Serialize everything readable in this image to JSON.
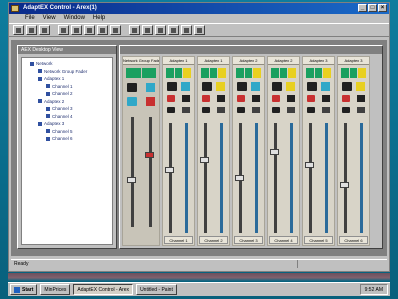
{
  "window": {
    "title": "AdaptEX Control - Arex(1)",
    "buttons": [
      "_",
      "□",
      "×"
    ]
  },
  "menu": [
    "File",
    "View",
    "Window",
    "Help"
  ],
  "toolbar": {
    "buttons": 14
  },
  "tree": {
    "caption": "AEX Desktop View",
    "nodes": [
      {
        "label": "Network",
        "level": 1
      },
      {
        "label": "Network Group Fader",
        "level": 2
      },
      {
        "label": "Adaptex 1",
        "level": 2
      },
      {
        "label": "Channel 1",
        "level": 3
      },
      {
        "label": "Channel 2",
        "level": 3
      },
      {
        "label": "Adaptex 2",
        "level": 2
      },
      {
        "label": "Channel 3",
        "level": 3
      },
      {
        "label": "Channel 4",
        "level": 3
      },
      {
        "label": "Adaptex 3",
        "level": 2
      },
      {
        "label": "Channel 5",
        "level": 3
      },
      {
        "label": "Channel 6",
        "level": 3
      }
    ]
  },
  "mixer": {
    "group_label": "Network Group Fader",
    "strips": [
      {
        "head": "Adaptex 1",
        "foot": "Channel 1"
      },
      {
        "head": "Adaptex 1",
        "foot": "Channel 2"
      },
      {
        "head": "Adaptex 2",
        "foot": "Channel 3"
      },
      {
        "head": "Adaptex 2",
        "foot": "Channel 4"
      },
      {
        "head": "Adaptex 3",
        "foot": "Channel 5"
      },
      {
        "head": "Adaptex 3",
        "foot": "Channel 6"
      }
    ]
  },
  "status": {
    "left": "Ready",
    "right": ""
  },
  "taskbar": {
    "start": "Start",
    "tasks": [
      "MinPrices",
      "AdaptEX Control - Arex",
      "Untitled - Paint"
    ],
    "active_index": 1,
    "clock": "9:52 AM"
  },
  "colors": {
    "green": "#1aa060",
    "yellow": "#e8d020",
    "cyan": "#30a8c8",
    "red": "#c83030"
  }
}
